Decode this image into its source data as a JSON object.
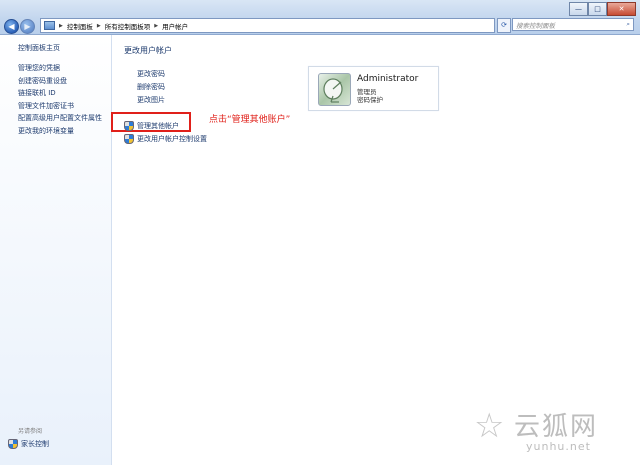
{
  "window": {
    "minimize": "—",
    "maximize": "□",
    "close": "✕"
  },
  "navigation": {
    "back_glyph": "◀",
    "forward_glyph": "▶",
    "breadcrumbs": [
      "控制面板",
      "所有控制面板项",
      "用户帐户"
    ],
    "search_placeholder": "搜索控制面板"
  },
  "sidebar": {
    "home": "控制面板主页",
    "items": [
      "管理您的凭据",
      "创建密码重设盘",
      "链接联机 ID",
      "管理文件加密证书",
      "配置高级用户配置文件属性",
      "更改我的环境变量"
    ],
    "see_also_title": "另请参阅",
    "see_also_items": [
      "家长控制"
    ]
  },
  "main": {
    "title": "更改用户帐户",
    "actions": [
      "更改密码",
      "删除密码",
      "更改图片"
    ],
    "manage_other": "管理其他帐户",
    "uac_settings": "更改用户帐户控制设置",
    "annotation": "点击“管理其他账户”"
  },
  "account": {
    "name": "Administrator",
    "role": "管理员",
    "status": "密码保护"
  },
  "watermark": {
    "brand": "云狐网",
    "url": "yunhu.net"
  },
  "colors": {
    "link": "#1e3b6e",
    "annotation": "#e0201a"
  }
}
